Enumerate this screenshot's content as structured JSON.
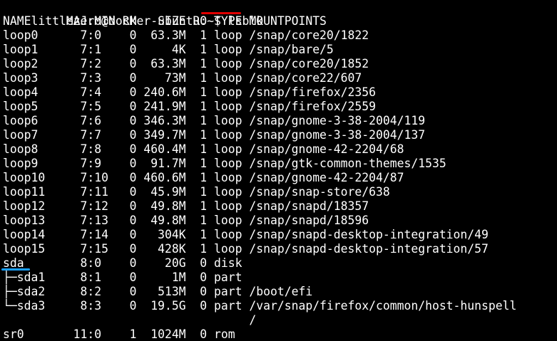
{
  "prompt": {
    "text": "littlezero@docker-ubuntu:~$ ",
    "command": "lsblk"
  },
  "header": "NAME     MAJ:MIN RM   SIZE RO TYPE MOUNTPOINTS",
  "rows": [
    "loop0      7:0    0  63.3M  1 loop /snap/core20/1822",
    "loop1      7:1    0     4K  1 loop /snap/bare/5",
    "loop2      7:2    0  63.3M  1 loop /snap/core20/1852",
    "loop3      7:3    0    73M  1 loop /snap/core22/607",
    "loop4      7:4    0 240.6M  1 loop /snap/firefox/2356",
    "loop5      7:5    0 241.9M  1 loop /snap/firefox/2559",
    "loop6      7:6    0 346.3M  1 loop /snap/gnome-3-38-2004/119",
    "loop7      7:7    0 349.7M  1 loop /snap/gnome-3-38-2004/137",
    "loop8      7:8    0 460.4M  1 loop /snap/gnome-42-2204/68",
    "loop9      7:9    0  91.7M  1 loop /snap/gtk-common-themes/1535",
    "loop10     7:10   0 460.6M  1 loop /snap/gnome-42-2204/87",
    "loop11     7:11   0  45.9M  1 loop /snap/snap-store/638",
    "loop12     7:12   0  49.8M  1 loop /snap/snapd/18357",
    "loop13     7:13   0  49.8M  1 loop /snap/snapd/18596",
    "loop14     7:14   0   304K  1 loop /snap/snapd-desktop-integration/49",
    "loop15     7:15   0   428K  1 loop /snap/snapd-desktop-integration/57",
    "sda        8:0    0    20G  0 disk",
    "├─sda1     8:1    0     1M  0 part",
    "├─sda2     8:2    0   513M  0 part /boot/efi",
    "└─sda3     8:3    0  19.5G  0 part /var/snap/firefox/common/host-hunspell",
    "                                   /",
    "sr0       11:0    1  1024M  0 rom"
  ],
  "colors": {
    "background": "#000000",
    "text": "#ffffff",
    "command_underline": "#e00000",
    "sda_underline": "#1aa0ff"
  }
}
